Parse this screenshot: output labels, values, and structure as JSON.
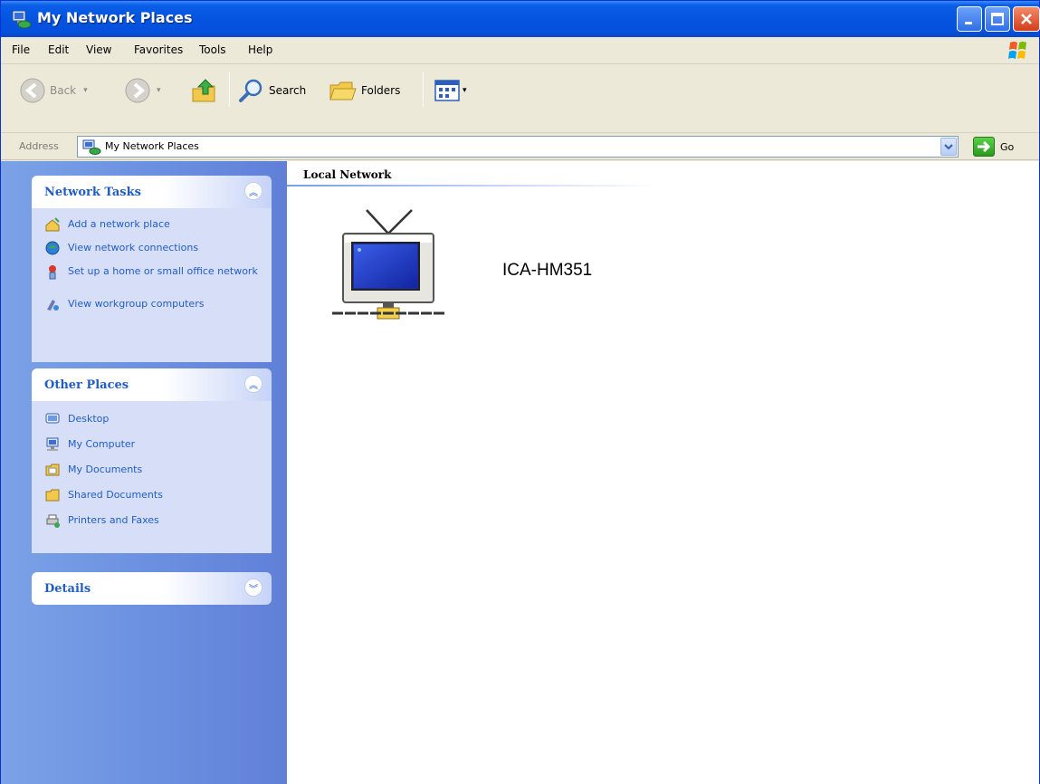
{
  "window": {
    "title": "My Network Places",
    "buttons": {
      "minimize": "minimize-icon",
      "maximize": "maximize-icon",
      "close": "close-icon"
    }
  },
  "menubar": {
    "items": [
      "File",
      "Edit",
      "View",
      "Favorites",
      "Tools",
      "Help"
    ]
  },
  "toolbar": {
    "back_label": "Back",
    "search_label": "Search",
    "folders_label": "Folders"
  },
  "address": {
    "label": "Address",
    "value": "My Network Places",
    "go_label": "Go"
  },
  "sidebar": {
    "network_tasks": {
      "title": "Network Tasks",
      "items": [
        {
          "label": "Add a network place",
          "icon": "add-network-place-icon"
        },
        {
          "label": "View network connections",
          "icon": "network-connections-icon"
        },
        {
          "label": "Set up a home or small office network",
          "icon": "setup-network-icon"
        },
        {
          "label": "View workgroup computers",
          "icon": "workgroup-computers-icon"
        }
      ]
    },
    "other_places": {
      "title": "Other Places",
      "items": [
        {
          "label": "Desktop",
          "icon": "desktop-icon"
        },
        {
          "label": "My Computer",
          "icon": "my-computer-icon"
        },
        {
          "label": "My Documents",
          "icon": "my-documents-icon"
        },
        {
          "label": "Shared Documents",
          "icon": "shared-documents-icon"
        },
        {
          "label": "Printers and Faxes",
          "icon": "printers-icon"
        }
      ]
    },
    "details": {
      "title": "Details"
    }
  },
  "content": {
    "group_title": "Local Network",
    "devices": [
      {
        "label": "ICA-HM351",
        "icon": "network-tv-icon"
      }
    ]
  },
  "colors": {
    "titlebar": "#0454e0",
    "sidebar_link": "#215dc6",
    "sidebar_bg": "#6b8fe0",
    "panel_body": "#d6dff7"
  }
}
